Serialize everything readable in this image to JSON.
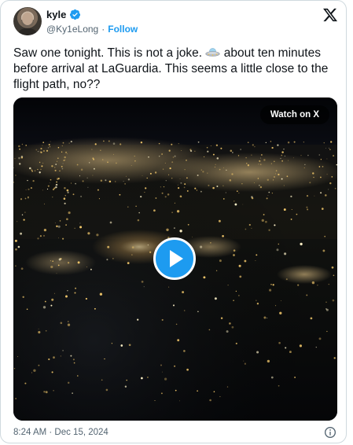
{
  "author": {
    "display_name": "kyle",
    "handle": "@Ky1eLong",
    "separator": "·",
    "follow_label": "Follow",
    "verified": true,
    "verified_color": "#1d9bf0"
  },
  "tweet": {
    "text_part1": "Saw one tonight. This is not a joke.",
    "emoji": "flying-saucer-icon",
    "text_part2": "about ten minutes before arrival at LaGuardia. This seems a little close to the flight path, no??"
  },
  "media": {
    "watch_label": "Watch on X",
    "play_icon": "play-icon"
  },
  "footer": {
    "timestamp": "8:24 AM · Dec 15, 2024",
    "info_icon": "info-icon"
  },
  "colors": {
    "accent": "#1d9bf0",
    "text": "#0f1419",
    "muted": "#536471",
    "border": "#cfd9de"
  }
}
